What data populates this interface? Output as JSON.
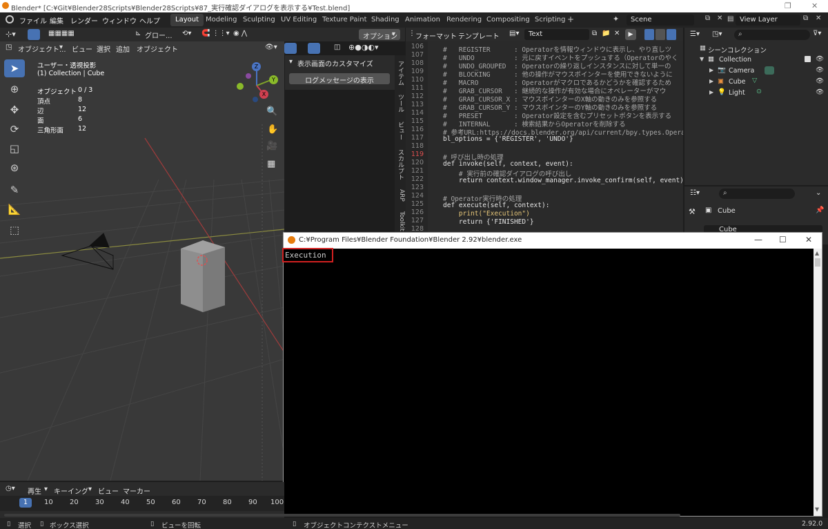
{
  "window": {
    "title": "Blender* [C:¥Git¥Blender28Scripts¥Blender28Scripts¥87_実行確認ダイアログを表示する¥Test.blend]"
  },
  "menu": [
    "ファイル",
    "編集",
    "レンダー",
    "ウィンドウ",
    "ヘルプ"
  ],
  "workspaces": [
    "Layout",
    "Modeling",
    "Sculpting",
    "UV Editing",
    "Texture Paint",
    "Shading",
    "Animation",
    "Rendering",
    "Compositing",
    "Scripting",
    "+"
  ],
  "scene": {
    "label": "Scene",
    "view_layer": "View Layer"
  },
  "viewport": {
    "transform_orientation": "グロー...",
    "options": "オプション",
    "mode": "オブジェクト...",
    "menu_view": "ビュー",
    "menu_select": "選択",
    "menu_add": "追加",
    "menu_object": "オブジェクト",
    "view_name": "ユーザー・透視投影",
    "collection_line": "(1) Collection | Cube",
    "stats": {
      "objects_label": "オブジェクト",
      "objects_value": "0 / 3",
      "verts_label": "頂点",
      "verts_value": "8",
      "edges_label": "辺",
      "edges_value": "12",
      "faces_label": "面",
      "faces_value": "6",
      "tris_label": "三角形面",
      "tris_value": "12"
    },
    "gizmo": {
      "z": "Z",
      "y": "Y",
      "x": "X"
    }
  },
  "npanel": {
    "header": "表示画面のカスタマイズ",
    "button": "ログメッセージの表示",
    "tabs": [
      "アイテム",
      "ツール",
      "ビュー",
      "スカルプト",
      "ARP",
      "Toolkit"
    ]
  },
  "text_editor": {
    "menu_format": "フォーマット",
    "menu_template": "テンプレート",
    "file_name": "Text",
    "lines": [
      {
        "n": "106",
        "t": "#   REGISTER      : Operatorを情報ウィンドウに表示し、やり直しツ",
        "c": "comment"
      },
      {
        "n": "107",
        "t": "#   UNDO          : 元に戻すイベントをプッシュする（Operatorのやく",
        "c": "comment"
      },
      {
        "n": "108",
        "t": "#   UNDO_GROUPED  : Operatorの繰り返しインスタンスに対して単一の",
        "c": "comment"
      },
      {
        "n": "109",
        "t": "#   BLOCKING      : 他の操作がマウスポインターを使用できないように",
        "c": "comment"
      },
      {
        "n": "110",
        "t": "#   MACRO         : Operatorがマクロであるかどうかを確認するため",
        "c": "comment"
      },
      {
        "n": "111",
        "t": "#   GRAB_CURSOR   : 継続的な操作が有効な場合にオペレーターがマウ",
        "c": "comment"
      },
      {
        "n": "112",
        "t": "#   GRAB_CURSOR_X : マウスポインターのX軸の動きのみを参照する",
        "c": "comment"
      },
      {
        "n": "113",
        "t": "#   GRAB_CURSOR_Y : マウスポインターのY軸の動きのみを参照する",
        "c": "comment"
      },
      {
        "n": "114",
        "t": "#   PRESET        : Operator設定を含むプリセットボタンを表示する",
        "c": "comment"
      },
      {
        "n": "115",
        "t": "#   INTERNAL      : 検索結果からOperatorを削除する",
        "c": "comment"
      },
      {
        "n": "116",
        "t": "# 参考URL:https://docs.blender.org/api/current/bpy.types.Operato",
        "c": "comment"
      },
      {
        "n": "117",
        "t": "bl_options = {'REGISTER', 'UNDO'}",
        "c": "plain"
      },
      {
        "n": "118",
        "t": "",
        "c": "plain"
      },
      {
        "n": "119",
        "t": "# 呼び出し時の処理",
        "c": "comment",
        "hl": true
      },
      {
        "n": "120",
        "t": "def invoke(self, context, event):",
        "c": "def"
      },
      {
        "n": "121",
        "t": "    # 実行前の確認ダイアログの呼び出し",
        "c": "comment"
      },
      {
        "n": "122",
        "t": "    return context.window_manager.invoke_confirm(self, event)",
        "c": "ret"
      },
      {
        "n": "123",
        "t": "",
        "c": "plain"
      },
      {
        "n": "124",
        "t": "# Operator実行時の処理",
        "c": "comment"
      },
      {
        "n": "125",
        "t": "def execute(self, context):",
        "c": "def"
      },
      {
        "n": "126",
        "t": "    print(\"Execution\")",
        "c": "print"
      },
      {
        "n": "127",
        "t": "    return {'FINISHED'}",
        "c": "ret2"
      },
      {
        "n": "128",
        "t": "",
        "c": "plain"
      }
    ]
  },
  "outliner": {
    "root": "シーンコレクション",
    "collection": "Collection",
    "items": [
      "Camera",
      "Cube",
      "Light"
    ]
  },
  "properties": {
    "object_name": "Cube",
    "data_name": "Cube"
  },
  "console": {
    "title": "C:¥Program Files¥Blender Foundation¥Blender 2.92¥blender.exe",
    "output": "Execution"
  },
  "timeline": {
    "menu_play": "再生",
    "menu_keying": "キーイング",
    "menu_view": "ビュー",
    "menu_marker": "マーカー",
    "current_frame": "1",
    "ticks": [
      "10",
      "20",
      "30",
      "40",
      "50",
      "60",
      "70",
      "80",
      "90",
      "100"
    ]
  },
  "statusbar": {
    "select": "選択",
    "box_select": "ボックス選択",
    "rotate_view": "ビューを回転",
    "context_menu": "オブジェクトコンテクストメニュー",
    "version": "2.92.0"
  }
}
